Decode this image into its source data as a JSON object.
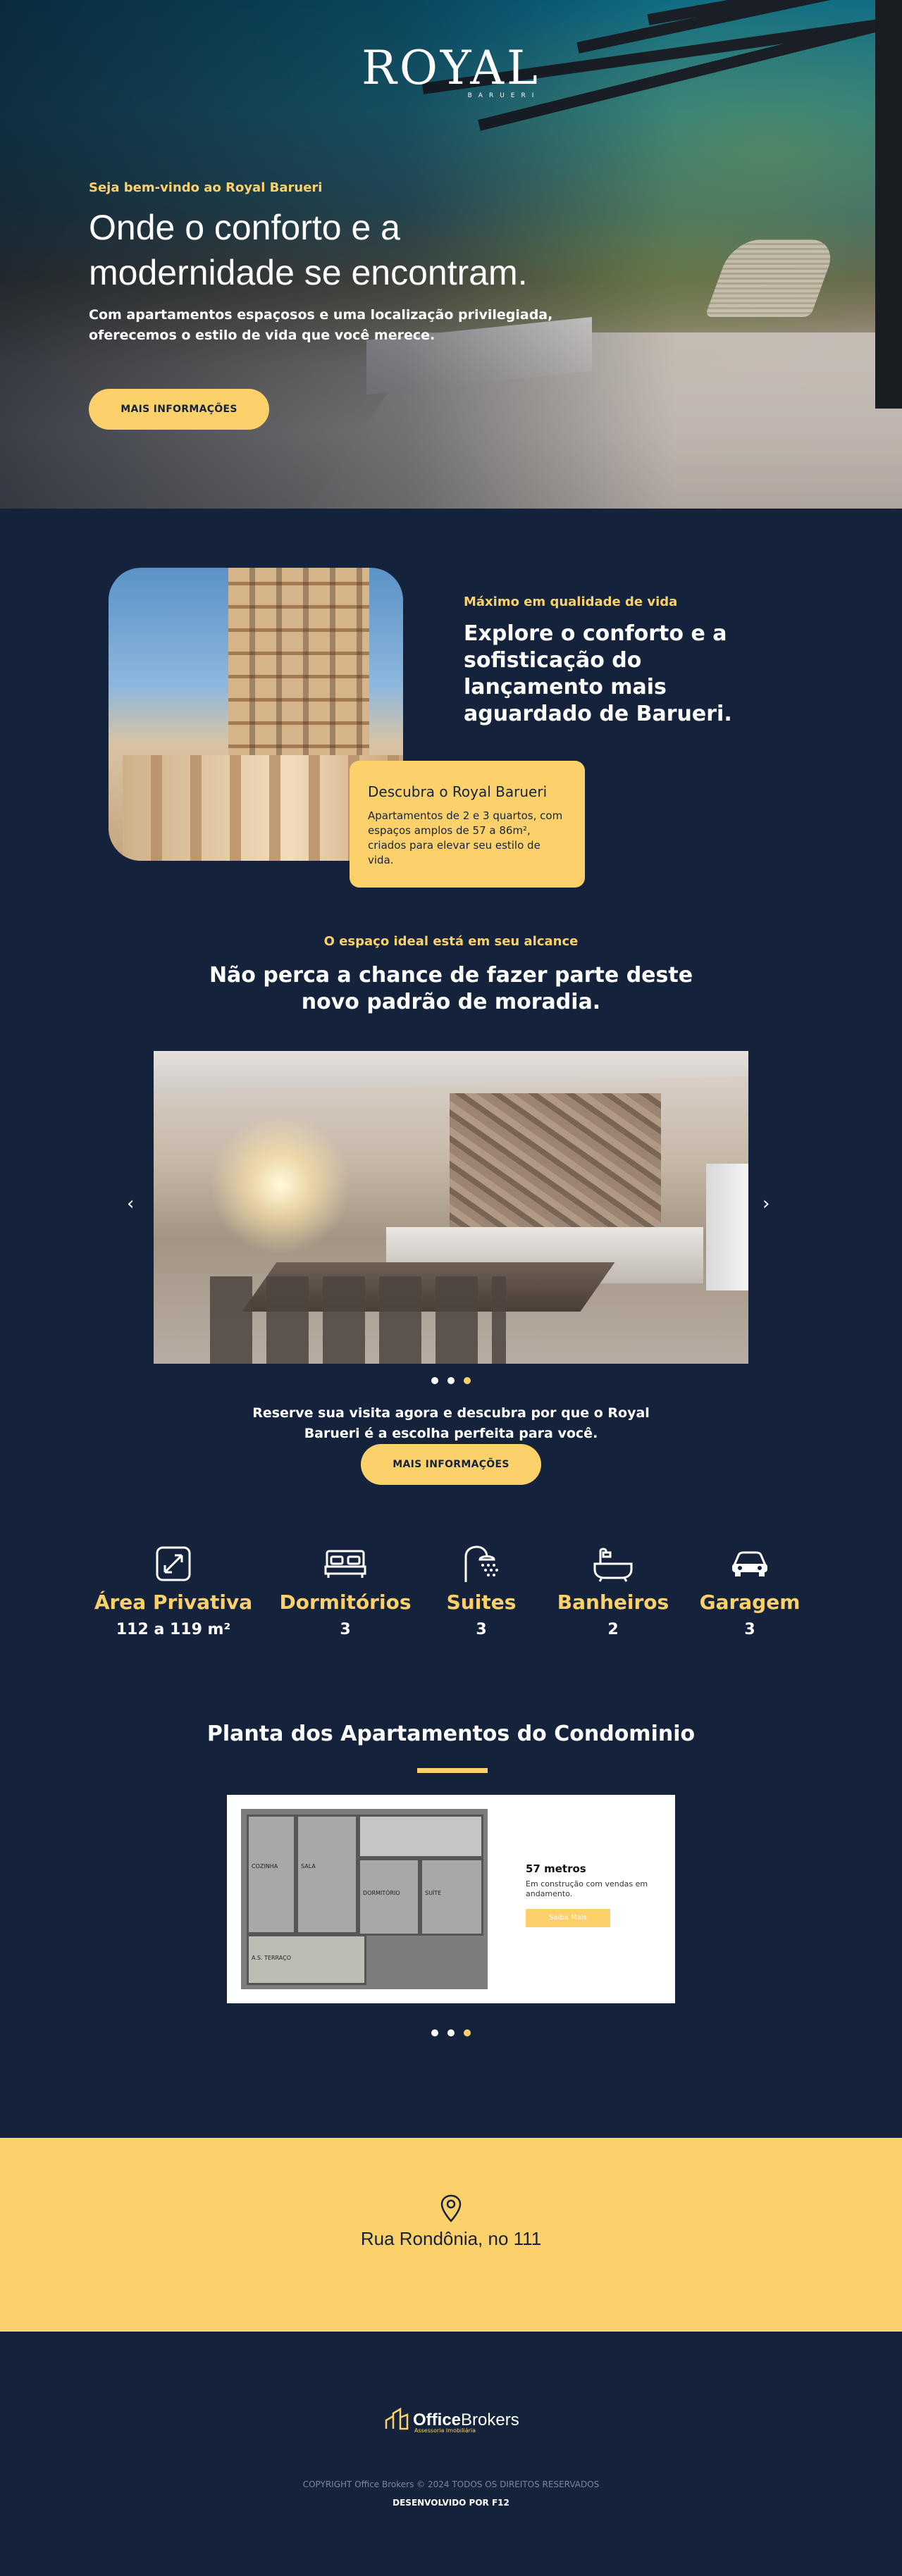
{
  "hero": {
    "logo": "ROYAL",
    "logo_sub": "BARUERI",
    "eyebrow": "Seja bem-vindo ao Royal Barueri",
    "title_line1": "Onde o conforto e a",
    "title_line2": "modernidade se encontram.",
    "desc": "Com apartamentos espaçosos e uma localização privilegiada, oferecemos o estilo de vida que você merece.",
    "button": "MAIS INFORMAÇÕES"
  },
  "intro": {
    "eyebrow": "Máximo em qualidade de vida",
    "title": "Explore o conforto e a sofisticação do lançamento mais aguardado de Barueri.",
    "callout_title": "Descubra o Royal Barueri",
    "callout_text": "Apartamentos de 2 e 3 quartos, com espaços amplos de 57 a 86m², criados para elevar seu estilo de vida."
  },
  "spaces": {
    "eyebrow": "O espaço ideal está em seu alcance",
    "title_line1": "Não perca a chance de fazer parte deste",
    "title_line2": "novo padrão de moradia.",
    "prev": "‹",
    "next": "›",
    "cta_line1": "Reserve sua visita agora e descubra por que o Royal",
    "cta_line2": "Barueri é a escolha perfeita para você.",
    "button": "MAIS INFORMAÇÕES",
    "active_slide": 3
  },
  "features": [
    {
      "label": "Área Privativa",
      "value": "112 a 119 m²",
      "icon": "expand-icon"
    },
    {
      "label": "Dormitórios",
      "value": "3",
      "icon": "bed-icon"
    },
    {
      "label": "Suites",
      "value": "3",
      "icon": "shower-icon"
    },
    {
      "label": "Banheiros",
      "value": "2",
      "icon": "bathtub-icon"
    },
    {
      "label": "Garagem",
      "value": "3",
      "icon": "car-icon"
    }
  ],
  "plans": {
    "title": "Planta dos Apartamentos do Condominio",
    "size": "57 metros",
    "status": "Em construção com vendas em andamento.",
    "button": "Saiba Mais",
    "rooms": [
      "COZINHA",
      "SALA",
      "DORMITÓRIO",
      "SUÍTE",
      "A.S. TERRAÇO"
    ],
    "active_slide": 3
  },
  "address": {
    "text": "Rua Rondônia, no 111"
  },
  "footer": {
    "brand_bold": "Office",
    "brand_rest": "Brokers",
    "tagline": "Assessoria Imobiliária",
    "copyright": "COPYRIGHT Office Brokers © 2024 TODOS OS DIREITOS RESERVADOS",
    "developer": "DESENVOLVIDO POR F12"
  },
  "colors": {
    "navy": "#14233b",
    "accent": "#fdd16a"
  }
}
